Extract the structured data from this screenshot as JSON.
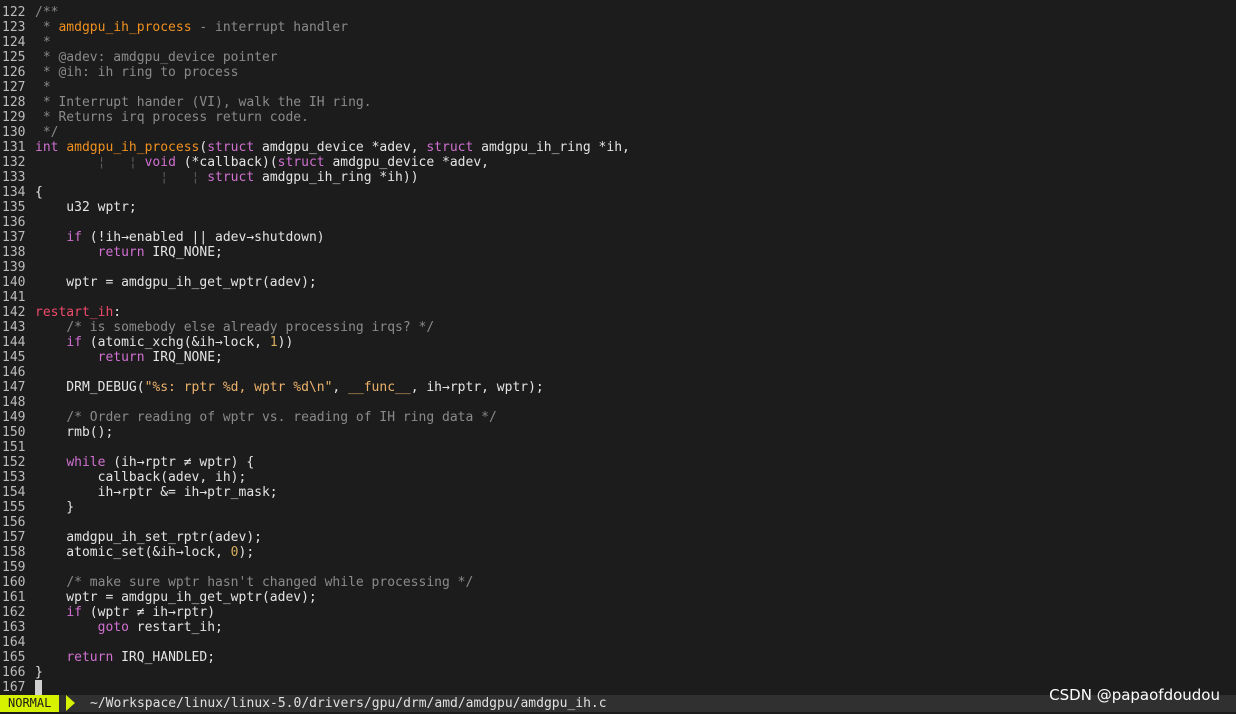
{
  "editor": {
    "colors": {
      "background": "#1c1c1c",
      "keyword": "#d070d0",
      "function": "#f09020",
      "comment": "#8a8a8a",
      "label": "#ee4a6a",
      "mode_bg": "#d7f200"
    },
    "lines": [
      {
        "n": "122",
        "tokens": [
          [
            "c",
            "/**"
          ]
        ]
      },
      {
        "n": "123",
        "tokens": [
          [
            "c",
            " * "
          ],
          [
            "dn",
            "amdgpu_ih_process"
          ],
          [
            "c",
            " - interrupt handler"
          ]
        ]
      },
      {
        "n": "124",
        "tokens": [
          [
            "c",
            " *"
          ]
        ]
      },
      {
        "n": "125",
        "tokens": [
          [
            "c",
            " * @adev: amdgpu_device pointer"
          ]
        ]
      },
      {
        "n": "126",
        "tokens": [
          [
            "c",
            " * @ih: ih ring to process"
          ]
        ]
      },
      {
        "n": "127",
        "tokens": [
          [
            "c",
            " *"
          ]
        ]
      },
      {
        "n": "128",
        "tokens": [
          [
            "c",
            " * Interrupt hander (VI), walk the IH ring."
          ]
        ]
      },
      {
        "n": "129",
        "tokens": [
          [
            "c",
            " * Returns irq process return code."
          ]
        ]
      },
      {
        "n": "130",
        "tokens": [
          [
            "c",
            " */"
          ]
        ]
      },
      {
        "n": "131",
        "tokens": [
          [
            "t",
            "int"
          ],
          [
            "d",
            " "
          ],
          [
            "f",
            "amdgpu_ih_process"
          ],
          [
            "d",
            "("
          ],
          [
            "k",
            "struct"
          ],
          [
            "d",
            " amdgpu_device *adev, "
          ],
          [
            "k",
            "struct"
          ],
          [
            "d",
            " amdgpu_ih_ring *ih,"
          ]
        ]
      },
      {
        "n": "132",
        "tokens": [
          [
            "d",
            "        "
          ],
          [
            "g",
            "¦"
          ],
          [
            "d",
            "   "
          ],
          [
            "g",
            "¦"
          ],
          [
            "d",
            " "
          ],
          [
            "t",
            "void"
          ],
          [
            "d",
            " (*callback)("
          ],
          [
            "k",
            "struct"
          ],
          [
            "d",
            " amdgpu_device *adev,"
          ]
        ]
      },
      {
        "n": "133",
        "tokens": [
          [
            "d",
            "                "
          ],
          [
            "g",
            "¦"
          ],
          [
            "d",
            "   "
          ],
          [
            "g",
            "¦"
          ],
          [
            "d",
            " "
          ],
          [
            "k",
            "struct"
          ],
          [
            "d",
            " amdgpu_ih_ring *ih))"
          ]
        ]
      },
      {
        "n": "134",
        "tokens": [
          [
            "d",
            "{"
          ]
        ]
      },
      {
        "n": "135",
        "tokens": [
          [
            "d",
            "    u32 wptr;"
          ]
        ]
      },
      {
        "n": "136",
        "tokens": []
      },
      {
        "n": "137",
        "tokens": [
          [
            "d",
            "    "
          ],
          [
            "k",
            "if"
          ],
          [
            "d",
            " (!ih→enabled || adev→shutdown)"
          ]
        ]
      },
      {
        "n": "138",
        "tokens": [
          [
            "d",
            "        "
          ],
          [
            "k",
            "return"
          ],
          [
            "d",
            " IRQ_NONE;"
          ]
        ]
      },
      {
        "n": "139",
        "tokens": []
      },
      {
        "n": "140",
        "tokens": [
          [
            "d",
            "    wptr = amdgpu_ih_get_wptr(adev);"
          ]
        ]
      },
      {
        "n": "141",
        "tokens": []
      },
      {
        "n": "142",
        "tokens": [
          [
            "l",
            "restart_ih"
          ],
          [
            "d",
            ":"
          ]
        ]
      },
      {
        "n": "143",
        "tokens": [
          [
            "d",
            "    "
          ],
          [
            "c",
            "/* is somebody else already processing irqs? */"
          ]
        ]
      },
      {
        "n": "144",
        "tokens": [
          [
            "d",
            "    "
          ],
          [
            "k",
            "if"
          ],
          [
            "d",
            " (atomic_xchg(&ih→lock, "
          ],
          [
            "nm",
            "1"
          ],
          [
            "d",
            "))"
          ]
        ]
      },
      {
        "n": "145",
        "tokens": [
          [
            "d",
            "        "
          ],
          [
            "k",
            "return"
          ],
          [
            "d",
            " IRQ_NONE;"
          ]
        ]
      },
      {
        "n": "146",
        "tokens": []
      },
      {
        "n": "147",
        "tokens": [
          [
            "d",
            "    DRM_DEBUG("
          ],
          [
            "s",
            "\"%s: rptr %d, wptr %d\\n\""
          ],
          [
            "d",
            ", "
          ],
          [
            "s",
            "__func__"
          ],
          [
            "d",
            ", ih→rptr, wptr);"
          ]
        ]
      },
      {
        "n": "148",
        "tokens": []
      },
      {
        "n": "149",
        "tokens": [
          [
            "d",
            "    "
          ],
          [
            "c",
            "/* Order reading of wptr vs. reading of IH ring data */"
          ]
        ]
      },
      {
        "n": "150",
        "tokens": [
          [
            "d",
            "    rmb();"
          ]
        ]
      },
      {
        "n": "151",
        "tokens": []
      },
      {
        "n": "152",
        "tokens": [
          [
            "d",
            "    "
          ],
          [
            "k",
            "while"
          ],
          [
            "d",
            " (ih→rptr ≠ wptr) {"
          ]
        ]
      },
      {
        "n": "153",
        "tokens": [
          [
            "d",
            "        callback(adev, ih);"
          ]
        ]
      },
      {
        "n": "154",
        "tokens": [
          [
            "d",
            "        ih→rptr &= ih→ptr_mask;"
          ]
        ]
      },
      {
        "n": "155",
        "tokens": [
          [
            "d",
            "    }"
          ]
        ]
      },
      {
        "n": "156",
        "tokens": []
      },
      {
        "n": "157",
        "tokens": [
          [
            "d",
            "    amdgpu_ih_set_rptr(adev);"
          ]
        ]
      },
      {
        "n": "158",
        "tokens": [
          [
            "d",
            "    atomic_set(&ih→lock, "
          ],
          [
            "nm",
            "0"
          ],
          [
            "d",
            ");"
          ]
        ]
      },
      {
        "n": "159",
        "tokens": []
      },
      {
        "n": "160",
        "tokens": [
          [
            "d",
            "    "
          ],
          [
            "c",
            "/* make sure wptr hasn't changed while processing */"
          ]
        ]
      },
      {
        "n": "161",
        "tokens": [
          [
            "d",
            "    wptr = amdgpu_ih_get_wptr(adev);"
          ]
        ]
      },
      {
        "n": "162",
        "tokens": [
          [
            "d",
            "    "
          ],
          [
            "k",
            "if"
          ],
          [
            "d",
            " (wptr ≠ ih→rptr)"
          ]
        ]
      },
      {
        "n": "163",
        "tokens": [
          [
            "d",
            "        "
          ],
          [
            "k",
            "goto"
          ],
          [
            "d",
            " restart_ih;"
          ]
        ]
      },
      {
        "n": "164",
        "tokens": []
      },
      {
        "n": "165",
        "tokens": [
          [
            "d",
            "    "
          ],
          [
            "k",
            "return"
          ],
          [
            "d",
            " IRQ_HANDLED;"
          ]
        ]
      },
      {
        "n": "166",
        "tokens": [
          [
            "d",
            "}"
          ]
        ]
      },
      {
        "n": "167",
        "tokens": []
      }
    ]
  },
  "statusline": {
    "mode": "NORMAL",
    "filepath": "~/Workspace/linux/linux-5.0/drivers/gpu/drm/amd/amdgpu/amdgpu_ih.c"
  },
  "watermark": "CSDN @papaofdoudou"
}
